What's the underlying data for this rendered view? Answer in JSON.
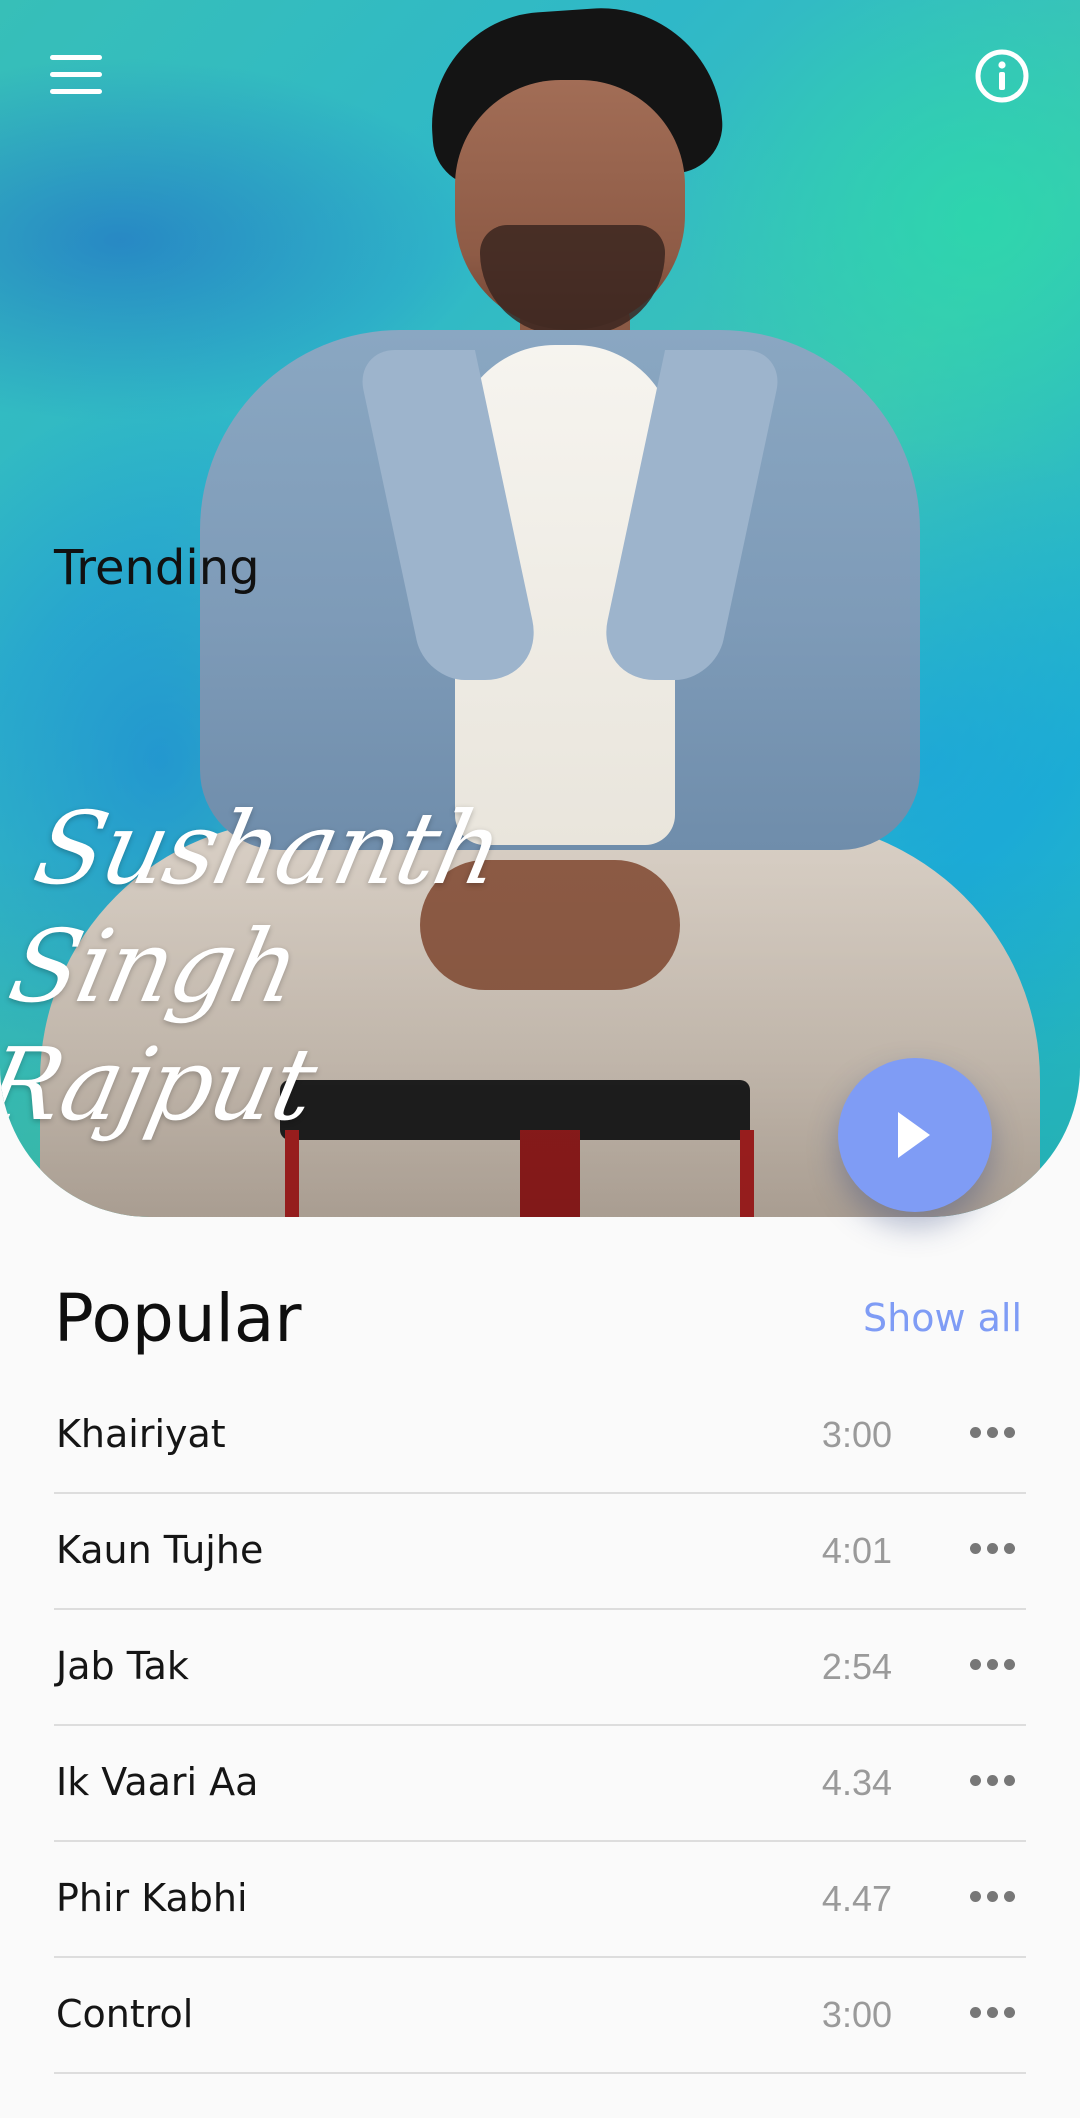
{
  "hero": {
    "section_label": "Trending",
    "artist_name_line1": "Sushanth",
    "artist_name_line2": "Singh Rajput",
    "icons": {
      "menu": "hamburger-menu-icon",
      "info": "info-icon",
      "play": "play-icon"
    },
    "colors": {
      "accent": "#7f9cf5",
      "background": "#37bfb8"
    }
  },
  "popular": {
    "title": "Popular",
    "show_all_label": "Show all",
    "tracks": [
      {
        "title": "Khairiyat",
        "duration": "3:00"
      },
      {
        "title": "Kaun Tujhe",
        "duration": "4:01"
      },
      {
        "title": "Jab Tak",
        "duration": "2:54"
      },
      {
        "title": "Ik Vaari Aa",
        "duration": "4.34"
      },
      {
        "title": "Phir Kabhi",
        "duration": "4.47"
      },
      {
        "title": "Control",
        "duration": "3:00"
      }
    ],
    "more_icon": "more-horizontal-icon"
  }
}
